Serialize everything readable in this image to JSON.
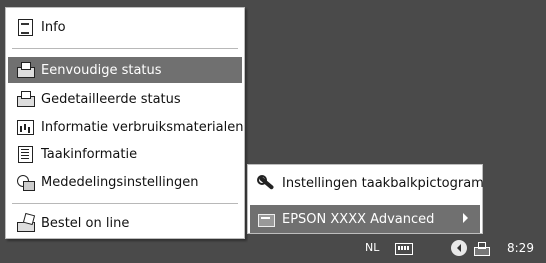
{
  "context_menu": {
    "items": [
      {
        "label": "Info",
        "icon": "info-document-icon"
      },
      {
        "label": "Eenvoudige status",
        "icon": "printer-status-icon",
        "selected": true
      },
      {
        "label": "Gedetailleerde status",
        "icon": "detailed-status-icon"
      },
      {
        "label": "Informatie verbruiksmaterialen",
        "icon": "consumables-icon"
      },
      {
        "label": "Taakinformatie",
        "icon": "job-info-icon"
      },
      {
        "label": "Mededelingsinstellingen",
        "icon": "notification-settings-icon"
      },
      {
        "label": "Bestel on line",
        "icon": "order-online-icon"
      }
    ]
  },
  "submenu": {
    "items": [
      {
        "label": "Instellingen taakbalkpictogram",
        "icon": "wrench-icon"
      },
      {
        "label": "EPSON XXXX Advanced",
        "icon": "epson-printer-icon",
        "selected": true,
        "has_submenu": true
      }
    ]
  },
  "taskbar": {
    "language": "NL",
    "clock": "8:29"
  },
  "colors": {
    "desktop": "#4a4a4a",
    "menu_bg": "#ffffff",
    "selection": "#707070"
  }
}
